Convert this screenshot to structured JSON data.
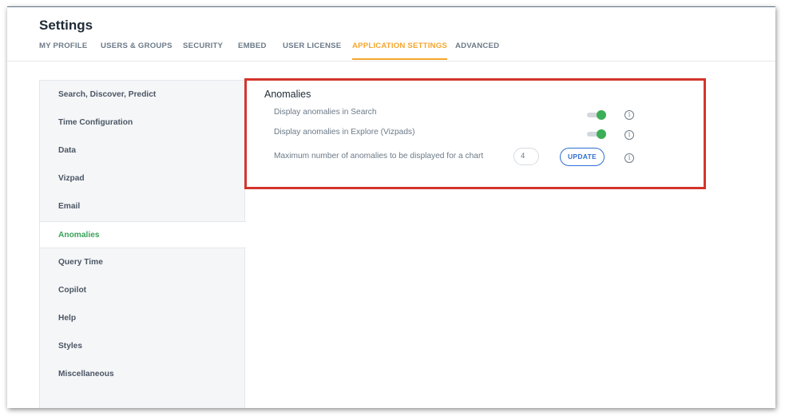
{
  "page": {
    "title": "Settings"
  },
  "tabs": [
    {
      "label": "MY PROFILE"
    },
    {
      "label": "USERS & GROUPS"
    },
    {
      "label": "SECURITY"
    },
    {
      "label": "EMBED"
    },
    {
      "label": "USER LICENSE"
    },
    {
      "label": "APPLICATION SETTINGS",
      "active": true
    },
    {
      "label": "ADVANCED"
    }
  ],
  "sidebar": {
    "items": [
      {
        "label": "Search, Discover, Predict"
      },
      {
        "label": "Time Configuration"
      },
      {
        "label": "Data"
      },
      {
        "label": "Vizpad"
      },
      {
        "label": "Email"
      },
      {
        "label": "Anomalies",
        "active": true
      },
      {
        "label": "Query Time"
      },
      {
        "label": "Copilot"
      },
      {
        "label": "Help"
      },
      {
        "label": "Styles"
      },
      {
        "label": "Miscellaneous"
      }
    ]
  },
  "anomalies": {
    "title": "Anomalies",
    "search_label": "Display anomalies in Search",
    "search_enabled": true,
    "explore_label": "Display anomalies in Explore (Vizpads)",
    "explore_enabled": true,
    "max_label": "Maximum number of anomalies to be displayed for a chart",
    "max_value": "4",
    "update_label": "UPDATE",
    "info_glyph": "i"
  },
  "colors": {
    "accent_tab": "#f5a52b",
    "active_sidebar": "#3aa35a",
    "toggle_on": "#3cae57",
    "button_blue": "#2e6fd1",
    "highlight": "#d3352c"
  }
}
